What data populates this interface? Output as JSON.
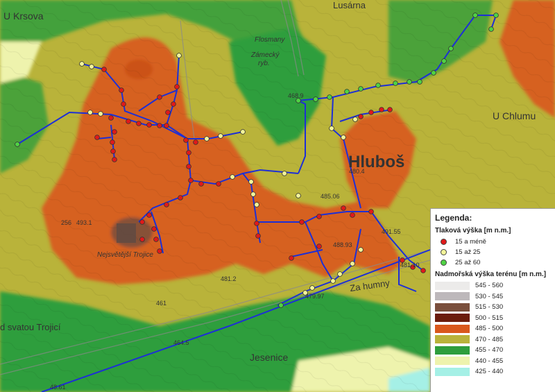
{
  "labels": {
    "village": "Hluboš",
    "street_krsova": "U Krsova",
    "street_lusarna": "Lusárna",
    "street_chlumu": "U Chlumu",
    "street_za_humny": "Za humny",
    "street_jesenice": "Jesenice",
    "street_trojici": "d svatou Trojicí",
    "place_trojice": "Nejsvětější Trojice",
    "place_zamecky": "Zámecký",
    "place_ryb": "ryb.",
    "place_flosmany": "Flosmany",
    "elev_493": "493.1",
    "elev_491": "491.55",
    "elev_488_93": "488.93",
    "elev_485": "485.06",
    "elev_480": "480.4",
    "elev_481": "481.2",
    "elev_479": "479.97",
    "elev_464": "464.5",
    "elev_468": "468.9",
    "elev_481_10": "481.10",
    "elev_256": "256",
    "elev_461": "461",
    "elev_48_61": "48.61"
  },
  "legend": {
    "title": "Legenda:",
    "pressure_title": "Tlaková výška [m n.m.]",
    "pressure_items": [
      {
        "label": "15 a méně",
        "color": "#e0191a"
      },
      {
        "label": "15 až 25",
        "color": "#f3f59a"
      },
      {
        "label": "25 až 60",
        "color": "#4fd244"
      }
    ],
    "terrain_title": "Nadmořská výška terénu [m n.m.]",
    "terrain_items": [
      {
        "label": "545 - 560",
        "color": "#ecebea"
      },
      {
        "label": "530 - 545",
        "color": "#bdb8bb"
      },
      {
        "label": "515 - 530",
        "color": "#7a4f3c"
      },
      {
        "label": "500 - 515",
        "color": "#6b1c0c"
      },
      {
        "label": "485 - 500",
        "color": "#d9581c"
      },
      {
        "label": "470 - 485",
        "color": "#b9b33a"
      },
      {
        "label": "455 - 470",
        "color": "#2e9e3c"
      },
      {
        "label": "440 - 455",
        "color": "#eef3ad"
      },
      {
        "label": "425 - 440",
        "color": "#a5f0e6"
      }
    ]
  }
}
